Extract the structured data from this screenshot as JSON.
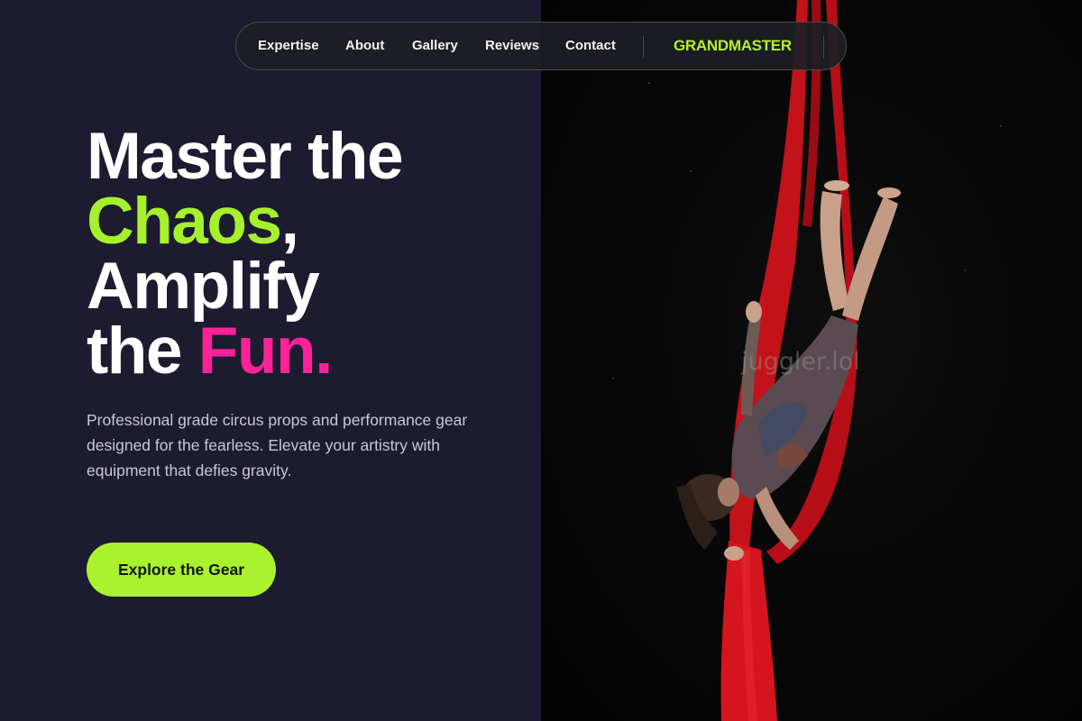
{
  "nav": {
    "links": [
      "Expertise",
      "About",
      "Gallery",
      "Reviews",
      "Contact"
    ],
    "brand": "GRANDMASTER"
  },
  "hero": {
    "headline": {
      "line1": "Master the",
      "line2_accent": "Chaos",
      "line2_rest": ",",
      "line3": "Amplify",
      "line4_start": "the ",
      "line4_accent": "Fun",
      "line4_end": "."
    },
    "description": "Professional grade circus props and performance gear designed for the fearless. Elevate your artistry with equipment that defies gravity.",
    "cta_label": "Explore the Gear"
  },
  "photo": {
    "watermark": "juggler.lol",
    "subject": "aerial-silks-performer"
  },
  "colors": {
    "background": "#1c1b2f",
    "accent_green": "#a6f02d",
    "accent_pink": "#ff2299",
    "silk_red": "#d2141c"
  }
}
